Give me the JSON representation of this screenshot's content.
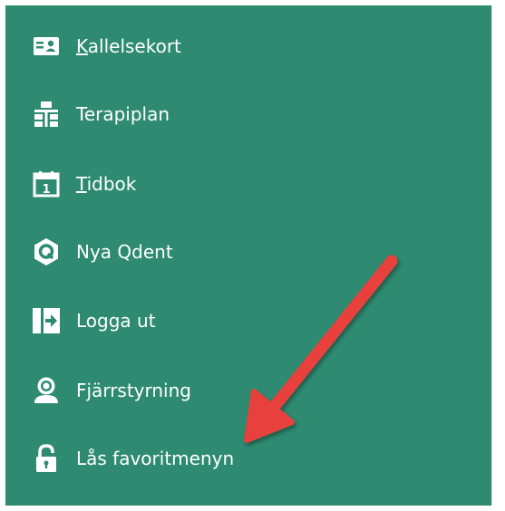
{
  "menu": {
    "items": [
      {
        "label_first": "K",
        "label_rest": "allelsekort",
        "icon": "id-card-icon"
      },
      {
        "label_first": "",
        "label_rest": "Terapiplan",
        "icon": "hierarchy-icon"
      },
      {
        "label_first": "T",
        "label_rest": "idbok",
        "icon": "calendar-icon"
      },
      {
        "label_first": "",
        "label_rest": "Nya Qdent",
        "icon": "qdent-logo-icon"
      },
      {
        "label_first": "",
        "label_rest": "Logga ut",
        "icon": "logout-icon"
      },
      {
        "label_first": "",
        "label_rest": "Fjärrstyrning",
        "icon": "remote-support-icon"
      },
      {
        "label_first": "",
        "label_rest": "Lås favoritmenyn",
        "icon": "lock-icon"
      }
    ]
  },
  "colors": {
    "panel_background": "#2e8b71",
    "text": "#ffffff",
    "arrow": "#e8413c"
  }
}
